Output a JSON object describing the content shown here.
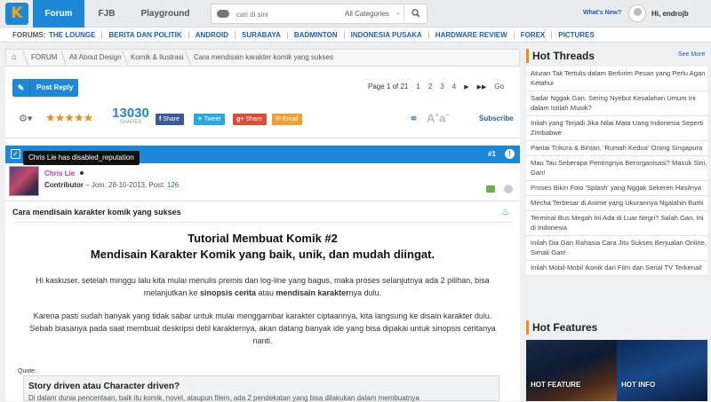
{
  "header": {
    "logo": "K",
    "tabs": [
      "Forum",
      "FJB",
      "Playground"
    ],
    "search_placeholder": "cari di sini",
    "search_category": "All Categories",
    "whats_new": "What's New?",
    "greeting": "Hi, endrojb"
  },
  "forums_bar": {
    "label": "FORUMS:",
    "items": [
      "THE LOUNGE",
      "BERITA DAN POLITIK",
      "ANDROID",
      "SURABAYA",
      "BADMINTON",
      "INDONESIA PUSAKA",
      "HARDWARE REVIEW",
      "FOREX",
      "PICTURES"
    ]
  },
  "breadcrumb": [
    "FORUM",
    "All About Design",
    "Komik & Ilustrasi",
    "Cara mendisain karakter komik yang sukses"
  ],
  "actions": {
    "post_reply": "Post Reply",
    "page_info": "Page 1 of 21",
    "pages": [
      "1",
      "2",
      "3",
      "4"
    ],
    "go": "Go"
  },
  "toolbar": {
    "share_count": "13030",
    "shares_label": "SHARES",
    "share_buttons": [
      "Share",
      "Tweet",
      "Share",
      "Email"
    ],
    "subscribe": "Subscribe",
    "colors": {
      "facebook": "#3b5998",
      "twitter": "#2aa9e0",
      "gplus": "#dd4b39",
      "email": "#f0a030"
    }
  },
  "post": {
    "number": "#1",
    "tooltip": "Chris Lie has disabled_reputation",
    "username": "Chris Lie",
    "role": "Contributor",
    "join_label": "Join: 28-10-2013, Post:",
    "post_count": "126",
    "title": "Cara mendisain karakter komik yang sukses",
    "heading1": "Tutorial Membuat Komik #2",
    "heading2": "Mendisain Karakter Komik yang baik, unik, dan mudah diingat.",
    "para1_a": "Hi kaskuser, setelah minggu lalu kita mulai menulis premis dan log-line yang bagus, maka proses selanjutnya ada 2 pilihan, bisa",
    "para1_b": "melanjutkan ke",
    "para1_bold1": "sinopsis cerita",
    "para1_mid": "atau",
    "para1_bold2": "mendisain karakter",
    "para1_end": "nya dulu.",
    "para2_a": "Karena pasti sudah banyak yang tidak sabar untuk mulai menggambar karakter ciptaannya, kita langsung ke disain karakter dulu.",
    "para2_b": "Sebab biasanya pada saat membuat deskripsi detil karakternya, akan datang banyak ide yang bisa dipakai untuk sinopsis ceritanya",
    "para2_c": "nanti.",
    "quote_label": "Quote:",
    "quote_title": "Story driven atau Character driven?",
    "quote_text": "Di dalam dunia penceritaan, baik itu komik, novel, ataupun filem, ada 2 pendekatan yang bisa dilakukan dalam membuatnya"
  },
  "sidebar": {
    "hot_threads_title": "Hot Threads",
    "see_more": "See More",
    "threads": [
      "Aturan Tak Tertulis dalam Berkirim Pesan yang Perlu Agan Ketahui",
      "Sadar Nggak Gan, Sering Nyebut Kesalahan Umum Ini dalam Istilah Musik?",
      "Inilah yang Terjadi Jika Nilai Mata Uang Indonesia Seperti Zimbabwe",
      "Pantai Trikora & Bintan, 'Rumah Kedua' Orang Singapura",
      "Mau Tau Seberapa Pentingnya Berorganisasi? Masuk Sini, Gan!",
      "Proses Bikin Foto 'Splash' yang Nggak Sekeren Hasilnya",
      "Mecha Terbesar di Anime yang Ukurannya Ngalahin Bumi",
      "Terminal Bus Megah Ini Ada di Luar Negri? Salah Gan, Ini di Indonesia",
      "Inilah Dia Gan Rahasia Cara Jitu Sukses Berjualan Online, Simak Gan!",
      "Inilah Mobil-Mobil Ikonik dari Film dan Serial TV Terkenal!"
    ],
    "hot_features_title": "Hot Features",
    "features": [
      "HOT FEATURE",
      "HOT INFO"
    ]
  }
}
